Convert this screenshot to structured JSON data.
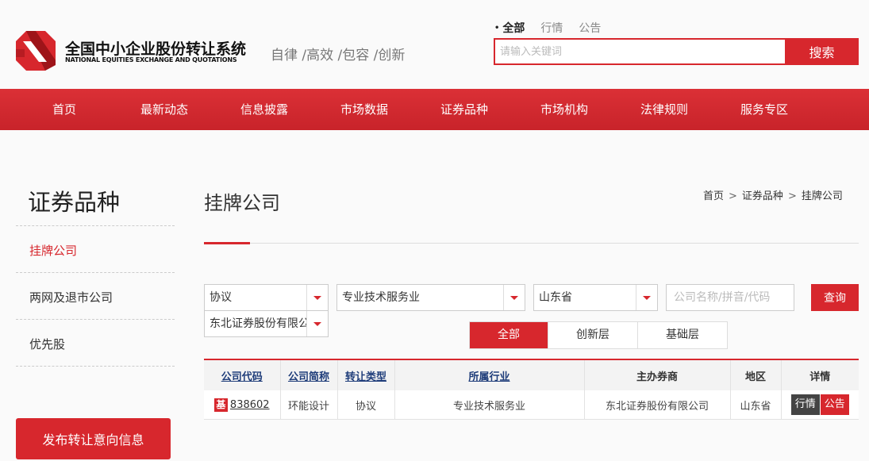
{
  "header": {
    "logo_cn": "全国中小企业股份转让系统",
    "logo_en": "NATIONAL EQUITIES EXCHANGE AND QUOTATIONS",
    "slogan": "自律 /高效 /包容 /创新",
    "search": {
      "tabs": [
        {
          "label": "全部",
          "active": true
        },
        {
          "label": "行情",
          "active": false
        },
        {
          "label": "公告",
          "active": false
        }
      ],
      "placeholder": "请输入关键词",
      "button": "搜索"
    }
  },
  "nav": {
    "items": [
      "首页",
      "最新动态",
      "信息披露",
      "市场数据",
      "证券品种",
      "市场机构",
      "法律规则",
      "服务专区"
    ]
  },
  "sidebar": {
    "title": "证券品种",
    "items": [
      {
        "label": "挂牌公司",
        "active": true
      },
      {
        "label": "两网及退市公司",
        "active": false
      },
      {
        "label": "优先股",
        "active": false
      }
    ],
    "publish_button": "发布转让意向信息"
  },
  "main": {
    "title": "挂牌公司",
    "breadcrumb": [
      "首页",
      "证券品种",
      "挂牌公司"
    ],
    "filters": {
      "transfer_type": "协议",
      "industry": "专业技术服务业",
      "region": "山东省",
      "broker": "东北证券股份有限公司",
      "keyword_placeholder": "公司名称/拼音/代码",
      "query_button": "查询"
    },
    "segments": [
      {
        "label": "全部",
        "active": true
      },
      {
        "label": "创新层",
        "active": false
      },
      {
        "label": "基础层",
        "active": false
      }
    ],
    "table": {
      "headers": [
        "公司代码",
        "公司简称",
        "转让类型",
        "所属行业",
        "主办券商",
        "地区",
        "详情"
      ],
      "rows": [
        {
          "tag": "基",
          "code": "838602",
          "name": "环能设计",
          "transfer_type": "协议",
          "industry": "专业技术服务业",
          "broker": "东北证券股份有限公司",
          "region": "山东省",
          "btn_quote": "行情",
          "btn_notice": "公告"
        }
      ]
    }
  },
  "colors": {
    "brand_red": "#d7272d",
    "dark_button": "#444444",
    "link_blue": "#1f3d7a"
  }
}
